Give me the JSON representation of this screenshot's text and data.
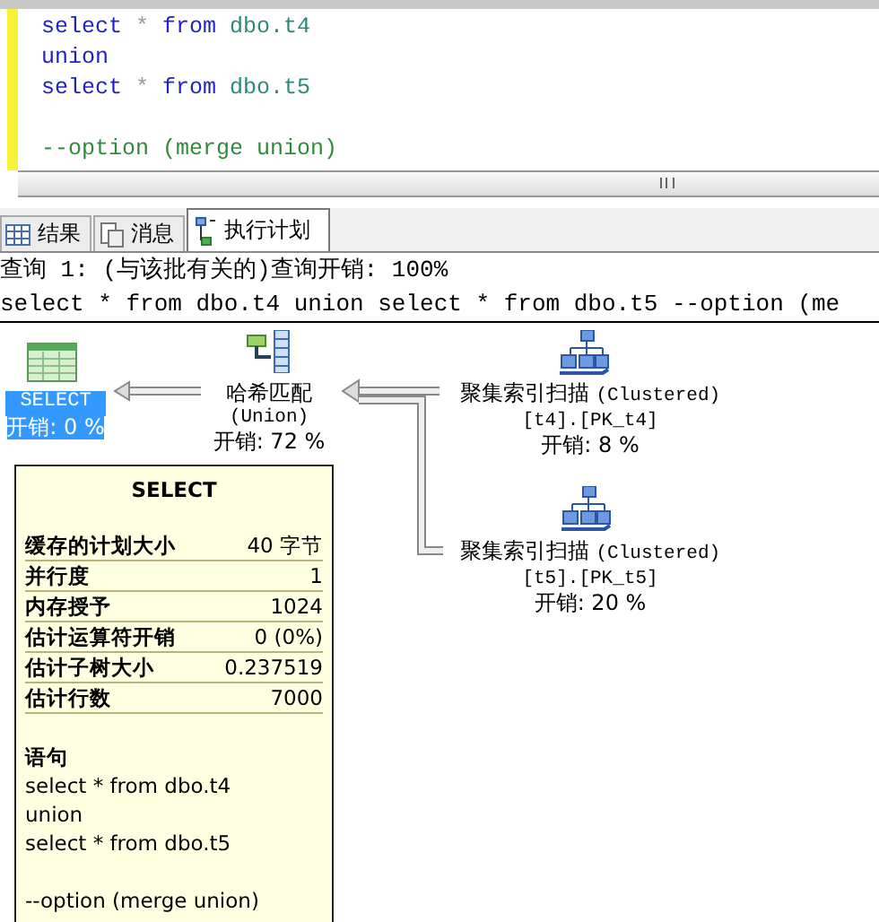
{
  "editor": {
    "lines": [
      {
        "blank_before": false,
        "tokens": [
          {
            "kind": "keyword",
            "text": "select"
          },
          {
            "kind": "operator",
            "text": "*"
          },
          {
            "kind": "keyword",
            "text": "from"
          },
          {
            "kind": "identifier",
            "text": "dbo.t4"
          }
        ]
      },
      {
        "blank_before": false,
        "tokens": [
          {
            "kind": "keyword",
            "text": "union"
          }
        ]
      },
      {
        "blank_before": false,
        "tokens": [
          {
            "kind": "keyword",
            "text": "select"
          },
          {
            "kind": "operator",
            "text": "*"
          },
          {
            "kind": "keyword",
            "text": "from"
          },
          {
            "kind": "identifier",
            "text": "dbo.t5"
          }
        ]
      },
      {
        "blank_before": true,
        "tokens": [
          {
            "kind": "comment",
            "text": "--option (merge union)"
          }
        ]
      }
    ]
  },
  "tabs": [
    {
      "label": "结果",
      "kind": "grid",
      "selected": false
    },
    {
      "label": "消息",
      "kind": "messages",
      "selected": false
    },
    {
      "label": "执行计划",
      "kind": "plan",
      "selected": true
    }
  ],
  "query_header": {
    "title": "查询 1: (与该批有关的)查询开销: 100%",
    "statement": "select * from dbo.t4 union select * from dbo.t5 --option (me"
  },
  "plan_nodes": [
    {
      "kind": "select",
      "name": "SELECT",
      "cost": "开销: 0 %",
      "selected": true
    },
    {
      "kind": "hash",
      "name": "哈希匹配",
      "object": "(Union)",
      "cost": "开销: 72 %",
      "selected": false
    },
    {
      "kind": "scan",
      "name": "聚集索引扫描",
      "physical": "(Clustered)",
      "object": "[t4].[PK_t4]",
      "cost": "开销: 8 %",
      "selected": false
    },
    {
      "kind": "scan",
      "name": "聚集索引扫描",
      "physical": "(Clustered)",
      "object": "[t5].[PK_t5]",
      "cost": "开销: 20 %",
      "selected": false
    }
  ],
  "tooltip": {
    "title": "SELECT",
    "rows": [
      {
        "label": "缓存的计划大小",
        "value": "40 字节"
      },
      {
        "label": "并行度",
        "value": "1"
      },
      {
        "label": "内存授予",
        "value": "1024"
      },
      {
        "label": "估计运算符开销",
        "value": "0 (0%)"
      },
      {
        "label": "估计子树大小",
        "value": "0.237519"
      },
      {
        "label": "估计行数",
        "value": "7000"
      }
    ],
    "statement_label": "语句",
    "statement_lines": [
      {
        "text": "select * from dbo.t4",
        "blank_before": false
      },
      {
        "text": "union",
        "blank_before": false
      },
      {
        "text": "select * from dbo.t5",
        "blank_before": false
      },
      {
        "text": "--option (merge union)",
        "blank_before": true
      }
    ]
  }
}
